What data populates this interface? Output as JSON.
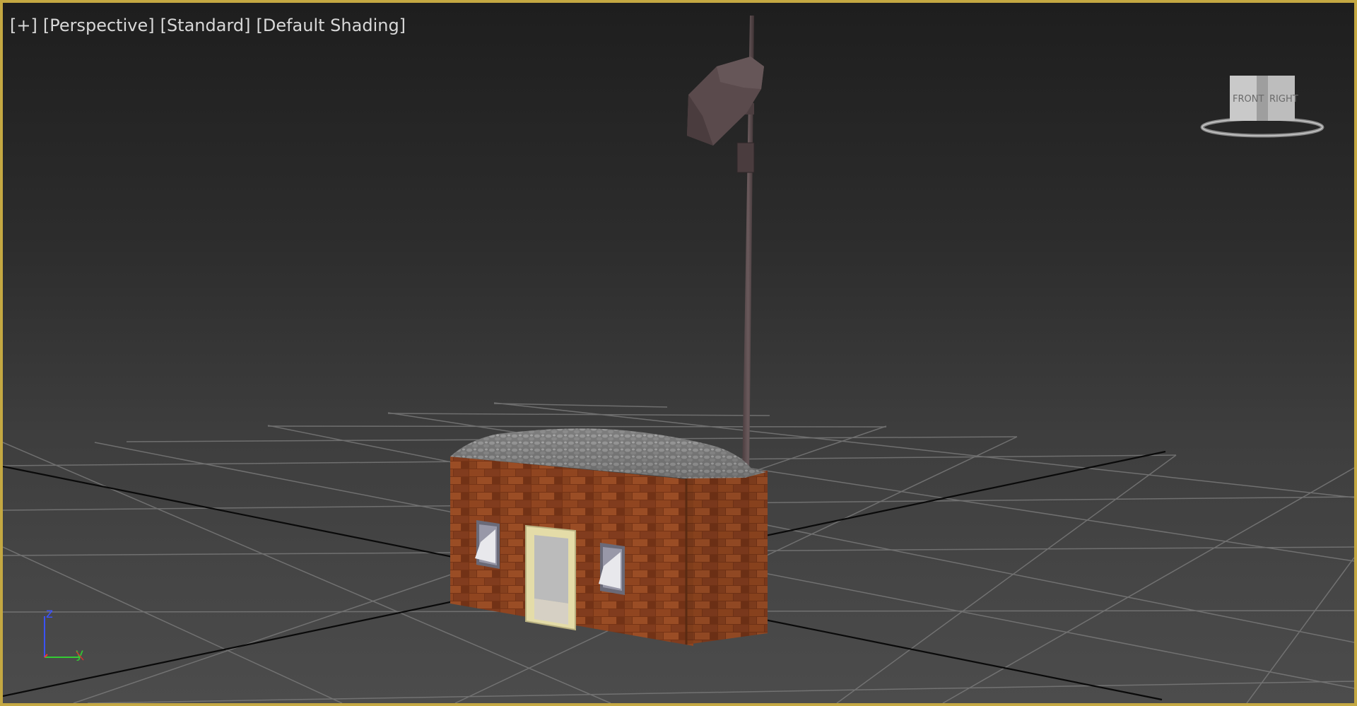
{
  "viewport": {
    "labels": {
      "plus": "[+]",
      "view": "[Perspective]",
      "mode": "[Standard]",
      "shading": "[Default Shading]"
    },
    "border_color": "#c4a842",
    "viewcube": {
      "front": "FRONT",
      "right": "RIGHT"
    },
    "axis_tripod": {
      "z": "z",
      "y": "y",
      "z_color": "#3a52ff",
      "y_color": "#33cc33",
      "x_color": "#ff3333"
    }
  },
  "scene": {
    "objects": [
      {
        "name": "brick-house",
        "material": "brick",
        "color": "#8a3d1c"
      },
      {
        "name": "roof",
        "material": "stone",
        "color": "#8a8a8a"
      },
      {
        "name": "door",
        "color": "#e8e2b0"
      },
      {
        "name": "window-left"
      },
      {
        "name": "window-right"
      },
      {
        "name": "lamp-pole",
        "color": "#5a4a4c"
      },
      {
        "name": "lamp-head",
        "color": "#5e4e50"
      }
    ]
  }
}
